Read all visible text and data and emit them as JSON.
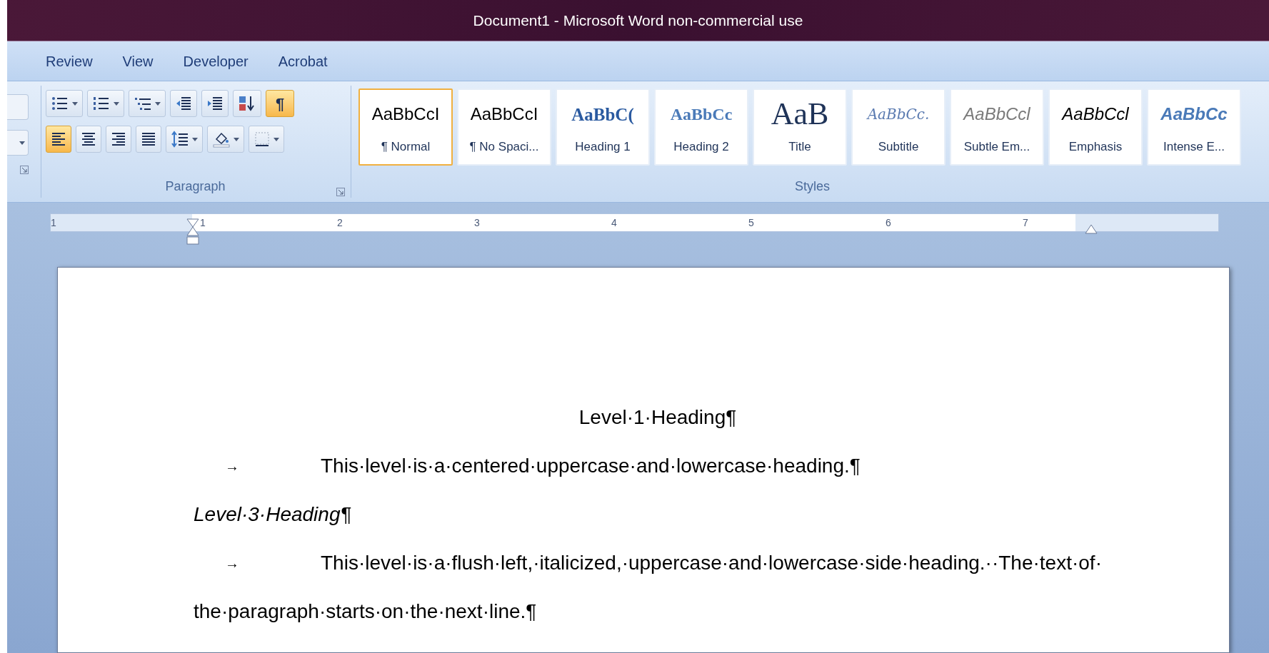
{
  "window": {
    "title": "Document1 - Microsoft Word non-commercial use"
  },
  "tabs": [
    {
      "label": "Review",
      "selected": false
    },
    {
      "label": "View",
      "selected": false
    },
    {
      "label": "Developer",
      "selected": false
    },
    {
      "label": "Acrobat",
      "selected": false
    }
  ],
  "paragraph_group": {
    "label": "Paragraph",
    "row_1": [
      {
        "kind": "bullets",
        "selected": false
      },
      {
        "kind": "numbering",
        "selected": false
      },
      {
        "kind": "multilevel",
        "selected": false
      },
      {
        "kind": "decrease_indent",
        "selected": false
      },
      {
        "kind": "increase_indent",
        "selected": false
      },
      {
        "kind": "sort",
        "selected": false
      },
      {
        "kind": "show_marks",
        "label": "¶",
        "selected": true
      }
    ],
    "row_2": [
      {
        "kind": "align_left",
        "selected": true
      },
      {
        "kind": "align_center",
        "selected": false
      },
      {
        "kind": "align_right",
        "selected": false
      },
      {
        "kind": "justify",
        "selected": false
      },
      {
        "kind": "line_spacing",
        "selected": false
      },
      {
        "kind": "shading",
        "selected": false
      },
      {
        "kind": "borders",
        "selected": false
      }
    ]
  },
  "styles_group": {
    "label": "Styles",
    "items": [
      {
        "kind": "normal",
        "sample": "AaBbCcI",
        "label": "¶ Normal",
        "selected": true
      },
      {
        "kind": "no_spacing",
        "sample": "AaBbCcI",
        "label": "¶ No Spaci...",
        "selected": false
      },
      {
        "kind": "heading1",
        "sample": "AaBbC(",
        "label": "Heading 1",
        "selected": false
      },
      {
        "kind": "heading2",
        "sample": "AaBbCc",
        "label": "Heading 2",
        "selected": false
      },
      {
        "kind": "title",
        "sample": "AaB",
        "label": "Title",
        "selected": false
      },
      {
        "kind": "subtitle",
        "sample": "AaBbCc.",
        "label": "Subtitle",
        "selected": false
      },
      {
        "kind": "subtle_emphasis",
        "sample": "AaBbCcl",
        "label": "Subtle Em...",
        "selected": false
      },
      {
        "kind": "emphasis",
        "sample": "AaBbCcl",
        "label": "Emphasis",
        "selected": false
      },
      {
        "kind": "intense_emphasis",
        "sample": "AaBbCc",
        "label": "Intense E...",
        "selected": false
      }
    ]
  },
  "ruler": {
    "labels": [
      "1",
      "1",
      "2",
      "3",
      "4",
      "5",
      "6",
      "7"
    ]
  },
  "document": {
    "paragraphs": [
      {
        "kind": "centered",
        "lines": [
          "Level·1·Heading¶"
        ]
      },
      {
        "kind": "tabbed",
        "tab": "→",
        "lines": [
          "This·level·is·a·centered·uppercase·and·lowercase·heading.¶"
        ]
      },
      {
        "kind": "italic",
        "lines": [
          "Level·3·Heading¶"
        ]
      },
      {
        "kind": "tabbed",
        "tab": "→",
        "lines": [
          "This·level·is·a·flush·left,·italicized,·uppercase·and·lowercase·side·heading.··The·text·of·",
          "the·paragraph·starts·on·the·next·line.¶"
        ]
      }
    ]
  }
}
